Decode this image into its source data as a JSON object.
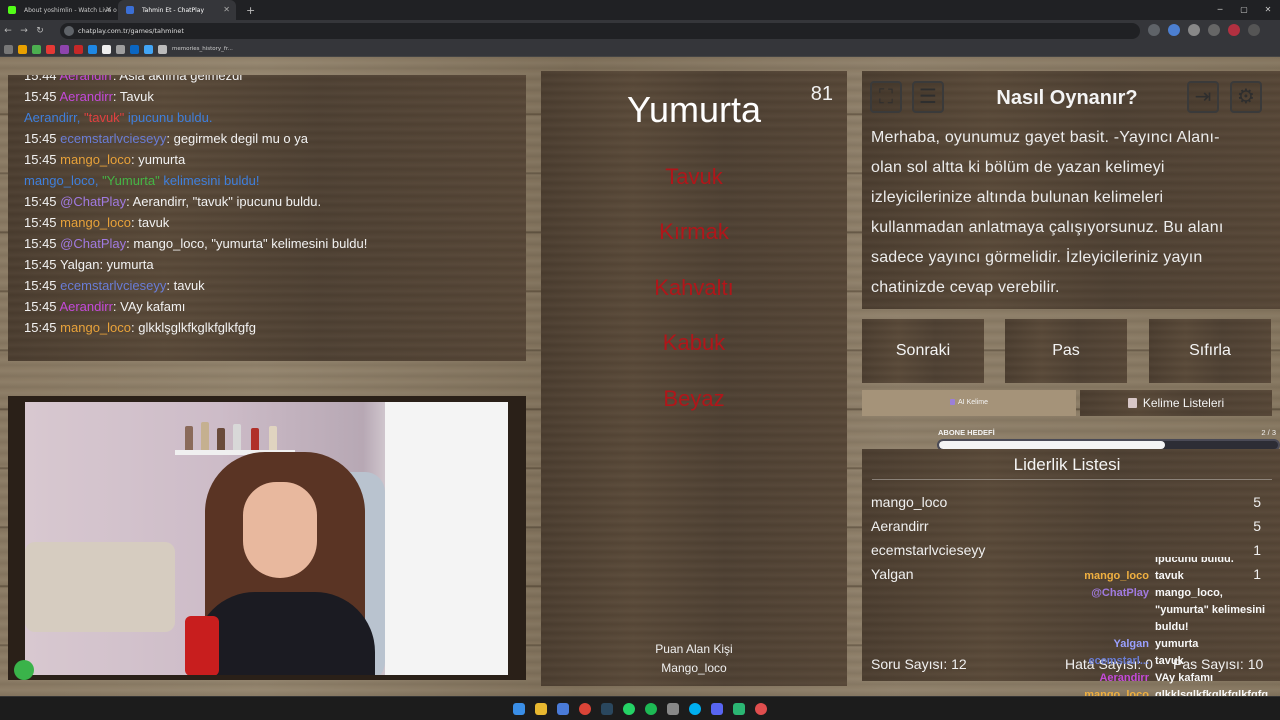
{
  "browser": {
    "tabs": [
      {
        "title": "About yoshimlin - Watch Live o",
        "favicon_color": "#53fc18",
        "active": false
      },
      {
        "title": "Tahmin Et - ChatPlay",
        "favicon_color": "#3b6fd6",
        "active": true
      }
    ],
    "url": "chatplay.com.tr/games/tahminet",
    "bookmark_folder": "memories_history_fr..."
  },
  "chat": {
    "lines": [
      {
        "time": "15:44",
        "user": "Aerandirr",
        "user_color": "aerandirr",
        "text": ": Asla aklıma gelmezdi"
      },
      {
        "time": "15:45",
        "user": "Aerandirr",
        "user_color": "aerandirr",
        "text": ": Tavuk"
      },
      {
        "system": true,
        "parts": [
          "Aerandirr, ",
          "\"tavuk\"",
          " ipucunu buldu."
        ]
      },
      {
        "time": "15:45",
        "user": "ecemstarlvcieseyy",
        "user_color": "ecem",
        "text": ": gegirmek degil mu o ya"
      },
      {
        "time": "15:45",
        "user": "mango_loco",
        "user_color": "mango",
        "text": ": yumurta"
      },
      {
        "system": true,
        "parts": [
          "mango_loco, ",
          "\"Yumurta\"",
          " kelimesini buldu!"
        ]
      },
      {
        "time": "15:45",
        "user": "@ChatPlay",
        "user_color": "chatplay",
        "text": ": Aerandirr, \"tavuk\" ipucunu buldu."
      },
      {
        "time": "15:45",
        "user": "mango_loco",
        "user_color": "mango",
        "text": ": tavuk"
      },
      {
        "time": "15:45",
        "user": "@ChatPlay",
        "user_color": "chatplay",
        "text": ": mango_loco, \"yumurta\" kelimesini buldu!"
      },
      {
        "time": "15:45",
        "user": "Yalgan",
        "user_color": "yalgan",
        "text": ": yumurta"
      },
      {
        "time": "15:45",
        "user": "ecemstarlvcieseyy",
        "user_color": "ecem",
        "text": ": tavuk"
      },
      {
        "time": "15:45",
        "user": "Aerandirr",
        "user_color": "aerandirr",
        "text": ": VAy kafamı"
      },
      {
        "time": "15:45",
        "user": "mango_loco",
        "user_color": "mango",
        "text": ": glkklşglkfkglkfglkfgfg"
      }
    ]
  },
  "game": {
    "timer": "81",
    "word": "Yumurta",
    "forbidden_words": [
      "Tavuk",
      "Kırmak",
      "Kahvaltı",
      "Kabuk",
      "Beyaz"
    ],
    "scorer_label": "Puan Alan Kişi",
    "scorer_name": "Mango_loco"
  },
  "info": {
    "title": "Nasıl Oynanır?",
    "text": "Merhaba, oyunumuz gayet basit. -Yayıncı Alanı- olan sol altta ki bölüm de yazan kelimeyi izleyicilerinize altında bulunan kelimeleri kullanmadan anlatmaya çalışıyorsunuz. Bu alanı sadece yayıncı görmelidir. İzleyicileriniz yayın chatinizde cevap verebilir.",
    "icons": [
      "fullscreen-icon",
      "notes-icon",
      "exit-icon",
      "gear-icon"
    ]
  },
  "controls": {
    "next": "Sonraki",
    "pass": "Pas",
    "reset": "Sıfırla",
    "ai_tab": "AI Kelime",
    "lists_tab": "Kelime Listeleri"
  },
  "subscriber_goal": {
    "label": "ABONE HEDEFİ",
    "count": "2 / 3",
    "progress": 0.667
  },
  "leaderboard": {
    "title": "Liderlik Listesi",
    "rows": [
      {
        "name": "mango_loco",
        "score": "5"
      },
      {
        "name": "Aerandirr",
        "score": "5"
      },
      {
        "name": "ecemstarlvcieseyy",
        "score": "1"
      },
      {
        "name": "Yalgan",
        "score": "1"
      }
    ],
    "question_count": "Soru Sayısı: 12",
    "error_count": "Hata Sayısı: 0",
    "pass_count": "Pas Sayısı: 10"
  },
  "overlay_chat": [
    {
      "user": "",
      "user_color": "#f0b040",
      "msg": "ipucunu buldu."
    },
    {
      "user": "mango_loco",
      "user_color": "#f0b040",
      "msg": "tavuk"
    },
    {
      "user": "@ChatPlay",
      "user_color": "#a07ae0",
      "msg": "mango_loco, \"yumurta\" kelimesini buldu!"
    },
    {
      "user": "Yalgan",
      "user_color": "#9aa0ff",
      "msg": "yumurta"
    },
    {
      "user": "ecemstarl...",
      "user_color": "#6a7dd6",
      "msg": "tavuk"
    },
    {
      "user": "Aerandirr",
      "user_color": "#c44ad9",
      "msg": "VAy kafamı"
    },
    {
      "user": "mango_loco",
      "user_color": "#f0b040",
      "msg": "glkklşglkfkglkfglkfgfg"
    }
  ],
  "colors": {
    "forbidden": "#b0161a",
    "system_chat": "#4a8be0"
  }
}
